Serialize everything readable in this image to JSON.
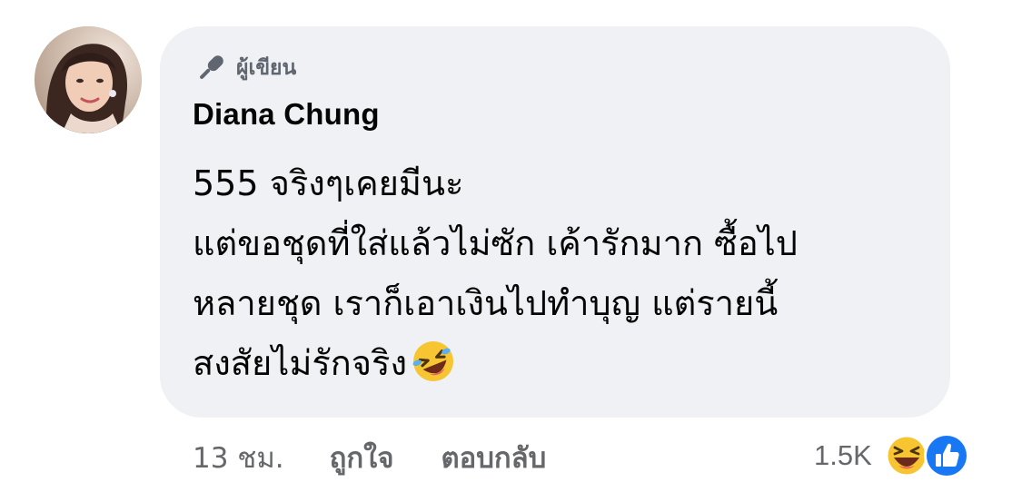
{
  "comment": {
    "author_badge": {
      "icon": "microphone-icon",
      "label": "ผู้เขียน"
    },
    "commenter_name": "Diana Chung",
    "avatar": "profile-photo",
    "text_lines": [
      "555 จริงๆเคยมีนะ",
      "แต่ขอชุดที่ใส่แล้วไม่ซัก  เค้ารักมาก ซื้อไป",
      "หลายชุด เราก็เอาเงินไปทำบุญ แต่รายนี้",
      "สงสัยไม่รักจริง"
    ],
    "inline_emoji": "rolling-on-the-floor-laughing-emoji",
    "colors": {
      "bubble_bg": "#eff1f4",
      "text": "#050505",
      "meta_text": "#65676b",
      "like_blue": "#1877f2",
      "haha_yellow": "#f7c531"
    }
  },
  "actions": {
    "timestamp": "13 ชม.",
    "like_label": "ถูกใจ",
    "reply_label": "ตอบกลับ"
  },
  "reactions": {
    "count": "1.5K",
    "icons": [
      "haha-icon",
      "like-icon"
    ]
  }
}
